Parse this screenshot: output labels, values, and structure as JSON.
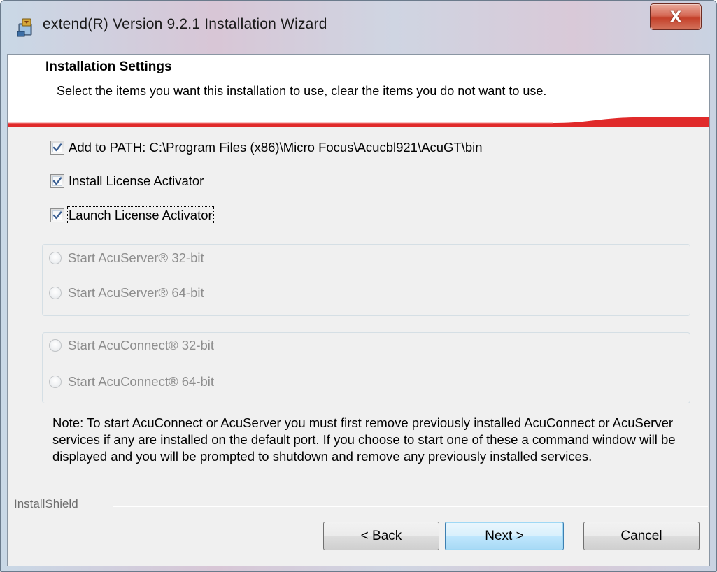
{
  "window": {
    "title": "extend(R) Version 9.2.1 Installation Wizard",
    "close_glyph": "X"
  },
  "banner": {
    "title": "Installation Settings",
    "description": "Select the items you want this installation to use, clear the items you do not want to use."
  },
  "options": [
    {
      "label": "Add to PATH: C:\\Program Files (x86)\\Micro Focus\\Acucbl921\\AcuGT\\bin",
      "checked": true
    },
    {
      "label": "Install License Activator",
      "checked": true
    },
    {
      "label": "Launch License Activator",
      "checked": true
    }
  ],
  "acuserver": [
    {
      "label": "Start AcuServer® 32-bit",
      "selected": false,
      "enabled": false
    },
    {
      "label": "Start AcuServer® 64-bit",
      "selected": false,
      "enabled": false
    }
  ],
  "acuconnect": [
    {
      "label": "Start AcuConnect® 32-bit",
      "selected": false,
      "enabled": false
    },
    {
      "label": "Start AcuConnect® 64-bit",
      "selected": false,
      "enabled": false
    }
  ],
  "note": "Note:  To start AcuConnect or AcuServer you must first remove previously installed AcuConnect or AcuServer services if any are installed on the default port.  If you choose to start one of these a command window will be displayed and you will be prompted to shutdown and remove any previously installed services.",
  "footer": {
    "brand": "InstallShield",
    "back_prefix": "< ",
    "back_mnemonic": "B",
    "back_suffix": "ack",
    "next_label": "Next >",
    "cancel_label": "Cancel"
  },
  "colors": {
    "accent_red": "#e02a2a",
    "default_button_border": "#3c7fb1",
    "disabled_text": "#8d8d8d"
  },
  "icons": {
    "window": "installer-icon",
    "close": "close-icon",
    "checkbox": "checkmark-icon"
  }
}
